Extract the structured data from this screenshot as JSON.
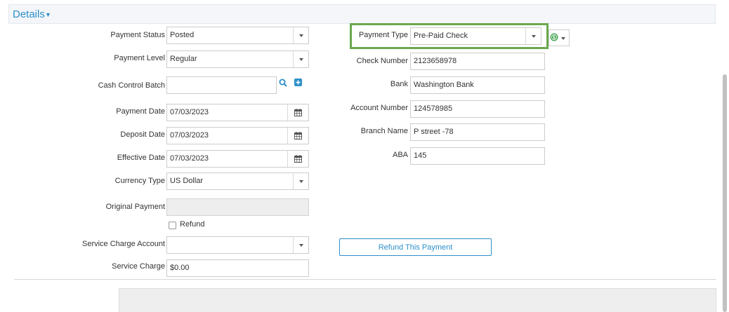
{
  "section": {
    "title": "Details"
  },
  "left": {
    "payment_status": {
      "label": "Payment Status",
      "value": "Posted"
    },
    "payment_level": {
      "label": "Payment Level",
      "value": "Regular"
    },
    "cash_control_batch": {
      "label": "Cash Control Batch",
      "value": ""
    },
    "payment_date": {
      "label": "Payment Date",
      "value": "07/03/2023"
    },
    "deposit_date": {
      "label": "Deposit Date",
      "value": "07/03/2023"
    },
    "effective_date": {
      "label": "Effective Date",
      "value": "07/03/2023"
    },
    "currency_type": {
      "label": "Currency Type",
      "value": "US Dollar"
    },
    "original_payment": {
      "label": "Original Payment",
      "value": ""
    },
    "refund": {
      "label": "Refund",
      "checked": false
    },
    "service_charge_account": {
      "label": "Service Charge Account",
      "value": ""
    },
    "service_charge": {
      "label": "Service Charge",
      "value": "$0.00"
    }
  },
  "right": {
    "payment_type": {
      "label": "Payment Type",
      "value": "Pre-Paid Check"
    },
    "check_number": {
      "label": "Check Number",
      "value": "2123658978"
    },
    "bank": {
      "label": "Bank",
      "value": "Washington Bank"
    },
    "account_number": {
      "label": "Account Number",
      "value": "124578985"
    },
    "branch_name": {
      "label": "Branch Name",
      "value": "P street -78"
    },
    "aba": {
      "label": "ABA",
      "value": "145"
    },
    "refund_button": "Refund This Payment"
  },
  "colors": {
    "accent": "#2d8fc9",
    "highlight": "#6aa84f",
    "currency_icon": "#3aa14a"
  },
  "icons": [
    "caret-down-icon",
    "chevron-down-icon",
    "calendar-icon",
    "search-icon",
    "plus-square-icon",
    "currency-icon"
  ]
}
